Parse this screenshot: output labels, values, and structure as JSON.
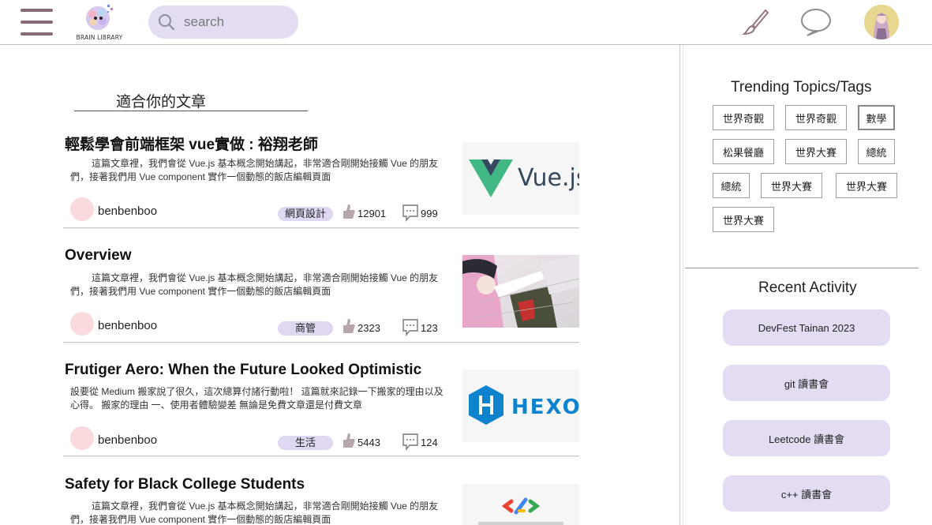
{
  "header": {
    "logo_text": "BRAIN LIBRARY",
    "search_placeholder": "search"
  },
  "feed": {
    "section_title": "適合你的文章",
    "articles": [
      {
        "title": "輕鬆學會前端框架 vue實做 : 裕翔老師",
        "excerpt": "這篇文章裡，我們會從 Vue.js 基本概念開始講起，非常適合剛開始接觸 Vue 的朋友們，接著我們用 Vue component 實作一個動態的飯店編輯頁面",
        "author": "benbenboo",
        "tag": "網頁設計",
        "likes": "12901",
        "comments": "999",
        "thumbnail": "vue-logo",
        "thumbnail_text": "Vue.js"
      },
      {
        "title": "Overview",
        "excerpt": "這篇文章裡，我們會從 Vue.js 基本概念開始講起，非常適合剛開始接觸 Vue 的朋友們，接著我們用 Vue component 實作一個動態的飯店編輯頁面",
        "author": "benbenboo",
        "tag": "商管",
        "likes": "2323",
        "comments": "123",
        "thumbnail": "anime-illustration"
      },
      {
        "title": "Frutiger Aero: When the Future Looked Optimistic",
        "excerpt": "設要從 Medium 搬家說了很久，這次總算付諸行動啦！ 這篇就來記錄一下搬家的理由以及心得。 搬家的理由 一、使用者體驗變差 無論是免費文章還是付費文章",
        "author": "benbenboo",
        "tag": "生活",
        "likes": "5443",
        "comments": "124",
        "thumbnail": "hexo-logo",
        "thumbnail_text": "HEXO"
      },
      {
        "title": "Safety for Black College Students",
        "excerpt": "這篇文章裡，我們會從 Vue.js 基本概念開始講起，非常適合剛開始接觸 Vue 的朋友們，接著我們用 Vue component 實作一個動態的飯店編輯頁面",
        "thumbnail": "google-dev-logo"
      }
    ]
  },
  "sidebar": {
    "trending_title": "Trending Topics/Tags",
    "tags": [
      "世界奇觀",
      "世界奇觀",
      "數學",
      "松果餐廳",
      "世界大賽",
      "總統",
      "總統",
      "世界大賽",
      "世界大賽",
      "世界大賽"
    ],
    "active_tag": "數學",
    "recent_title": "Recent Activity",
    "activities": [
      "DevFest Tainan 2023",
      "git 讀書會",
      "Leetcode 讀書會",
      "c++ 讀書會"
    ]
  },
  "colors": {
    "accent_lavender": "#e4dcf3",
    "menu_icon": "#8a6a78",
    "author_avatar": "#fadadd"
  }
}
